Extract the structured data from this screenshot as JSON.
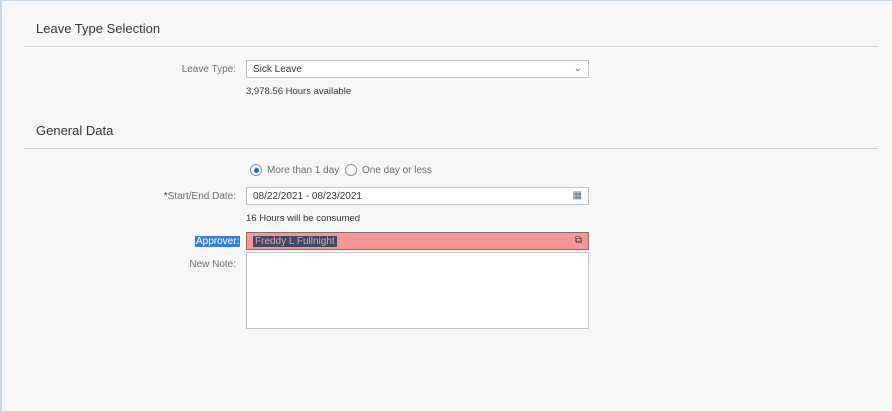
{
  "sections": {
    "leave_type": "Leave Type Selection",
    "general": "General Data"
  },
  "leave_type": {
    "label": "Leave Type:",
    "value": "Sick Leave",
    "available": "3,978.56 Hours available"
  },
  "duration": {
    "options": [
      "More than 1 day",
      "One day or less"
    ],
    "selected": 0
  },
  "dates": {
    "label": "*Start/End Date:",
    "required_mark": "*",
    "label_text": "Start/End Date:",
    "value": "08/22/2021 - 08/23/2021",
    "consumed": "16 Hours will be consumed"
  },
  "approver": {
    "label": "Approver:",
    "value": "Freddy L Fullnight"
  },
  "note": {
    "label": "New Note:",
    "value": ""
  }
}
